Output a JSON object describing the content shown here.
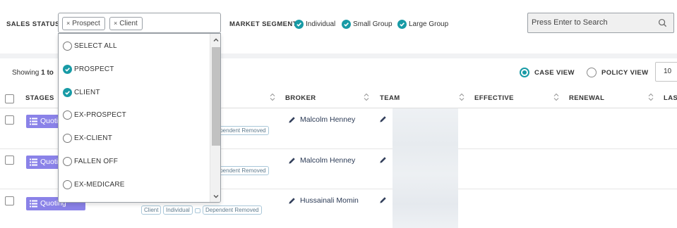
{
  "filters": {
    "sales_status_label": "SALES STATUS",
    "selected_chips": [
      {
        "remove": "×",
        "label": "Prospect"
      },
      {
        "remove": "×",
        "label": "Client"
      }
    ],
    "market_segment_label": "MARKET SEGMENT",
    "segments": [
      {
        "label": "Individual",
        "checked": true
      },
      {
        "label": "Small Group",
        "checked": true
      },
      {
        "label": "Large Group",
        "checked": true
      }
    ],
    "search_placeholder": "Press Enter to Search",
    "search_icon": "search-icon"
  },
  "dropdown": {
    "options": [
      {
        "label": "SELECT ALL",
        "checked": false
      },
      {
        "label": "PROSPECT",
        "checked": true
      },
      {
        "label": "CLIENT",
        "checked": true
      },
      {
        "label": "EX-PROSPECT",
        "checked": false
      },
      {
        "label": "EX-CLIENT",
        "checked": false
      },
      {
        "label": "FALLEN OFF",
        "checked": false
      },
      {
        "label": "EX-MEDICARE",
        "checked": false
      }
    ]
  },
  "listing": {
    "showing_prefix": "Showing ",
    "showing_range": "1 to",
    "views": [
      {
        "label": "CASE VIEW",
        "selected": true
      },
      {
        "label": "POLICY VIEW",
        "selected": false
      }
    ],
    "page_size": "10"
  },
  "table": {
    "headers": {
      "stages": "STAGES",
      "broker": "BROKER",
      "team": "TEAM",
      "effective": "EFFECTIVE",
      "renewal": "RENEWAL",
      "last": "LAST"
    },
    "rows": [
      {
        "stage": "Quoting",
        "broker": "Malcolm Henney",
        "tags": [
          "Dependent Removed"
        ]
      },
      {
        "stage": "Quoting",
        "broker": "Malcolm Henney",
        "tags": [
          "Dependent Removed"
        ]
      },
      {
        "stage": "Quoting",
        "broker": "Hussainali Momin",
        "tags": [
          "Client",
          "Individual",
          "Dependent Removed"
        ]
      }
    ]
  },
  "colors": {
    "accent": "#189ba6",
    "stage_button": "#8a82e8",
    "tag_border": "#a9c7d9"
  }
}
